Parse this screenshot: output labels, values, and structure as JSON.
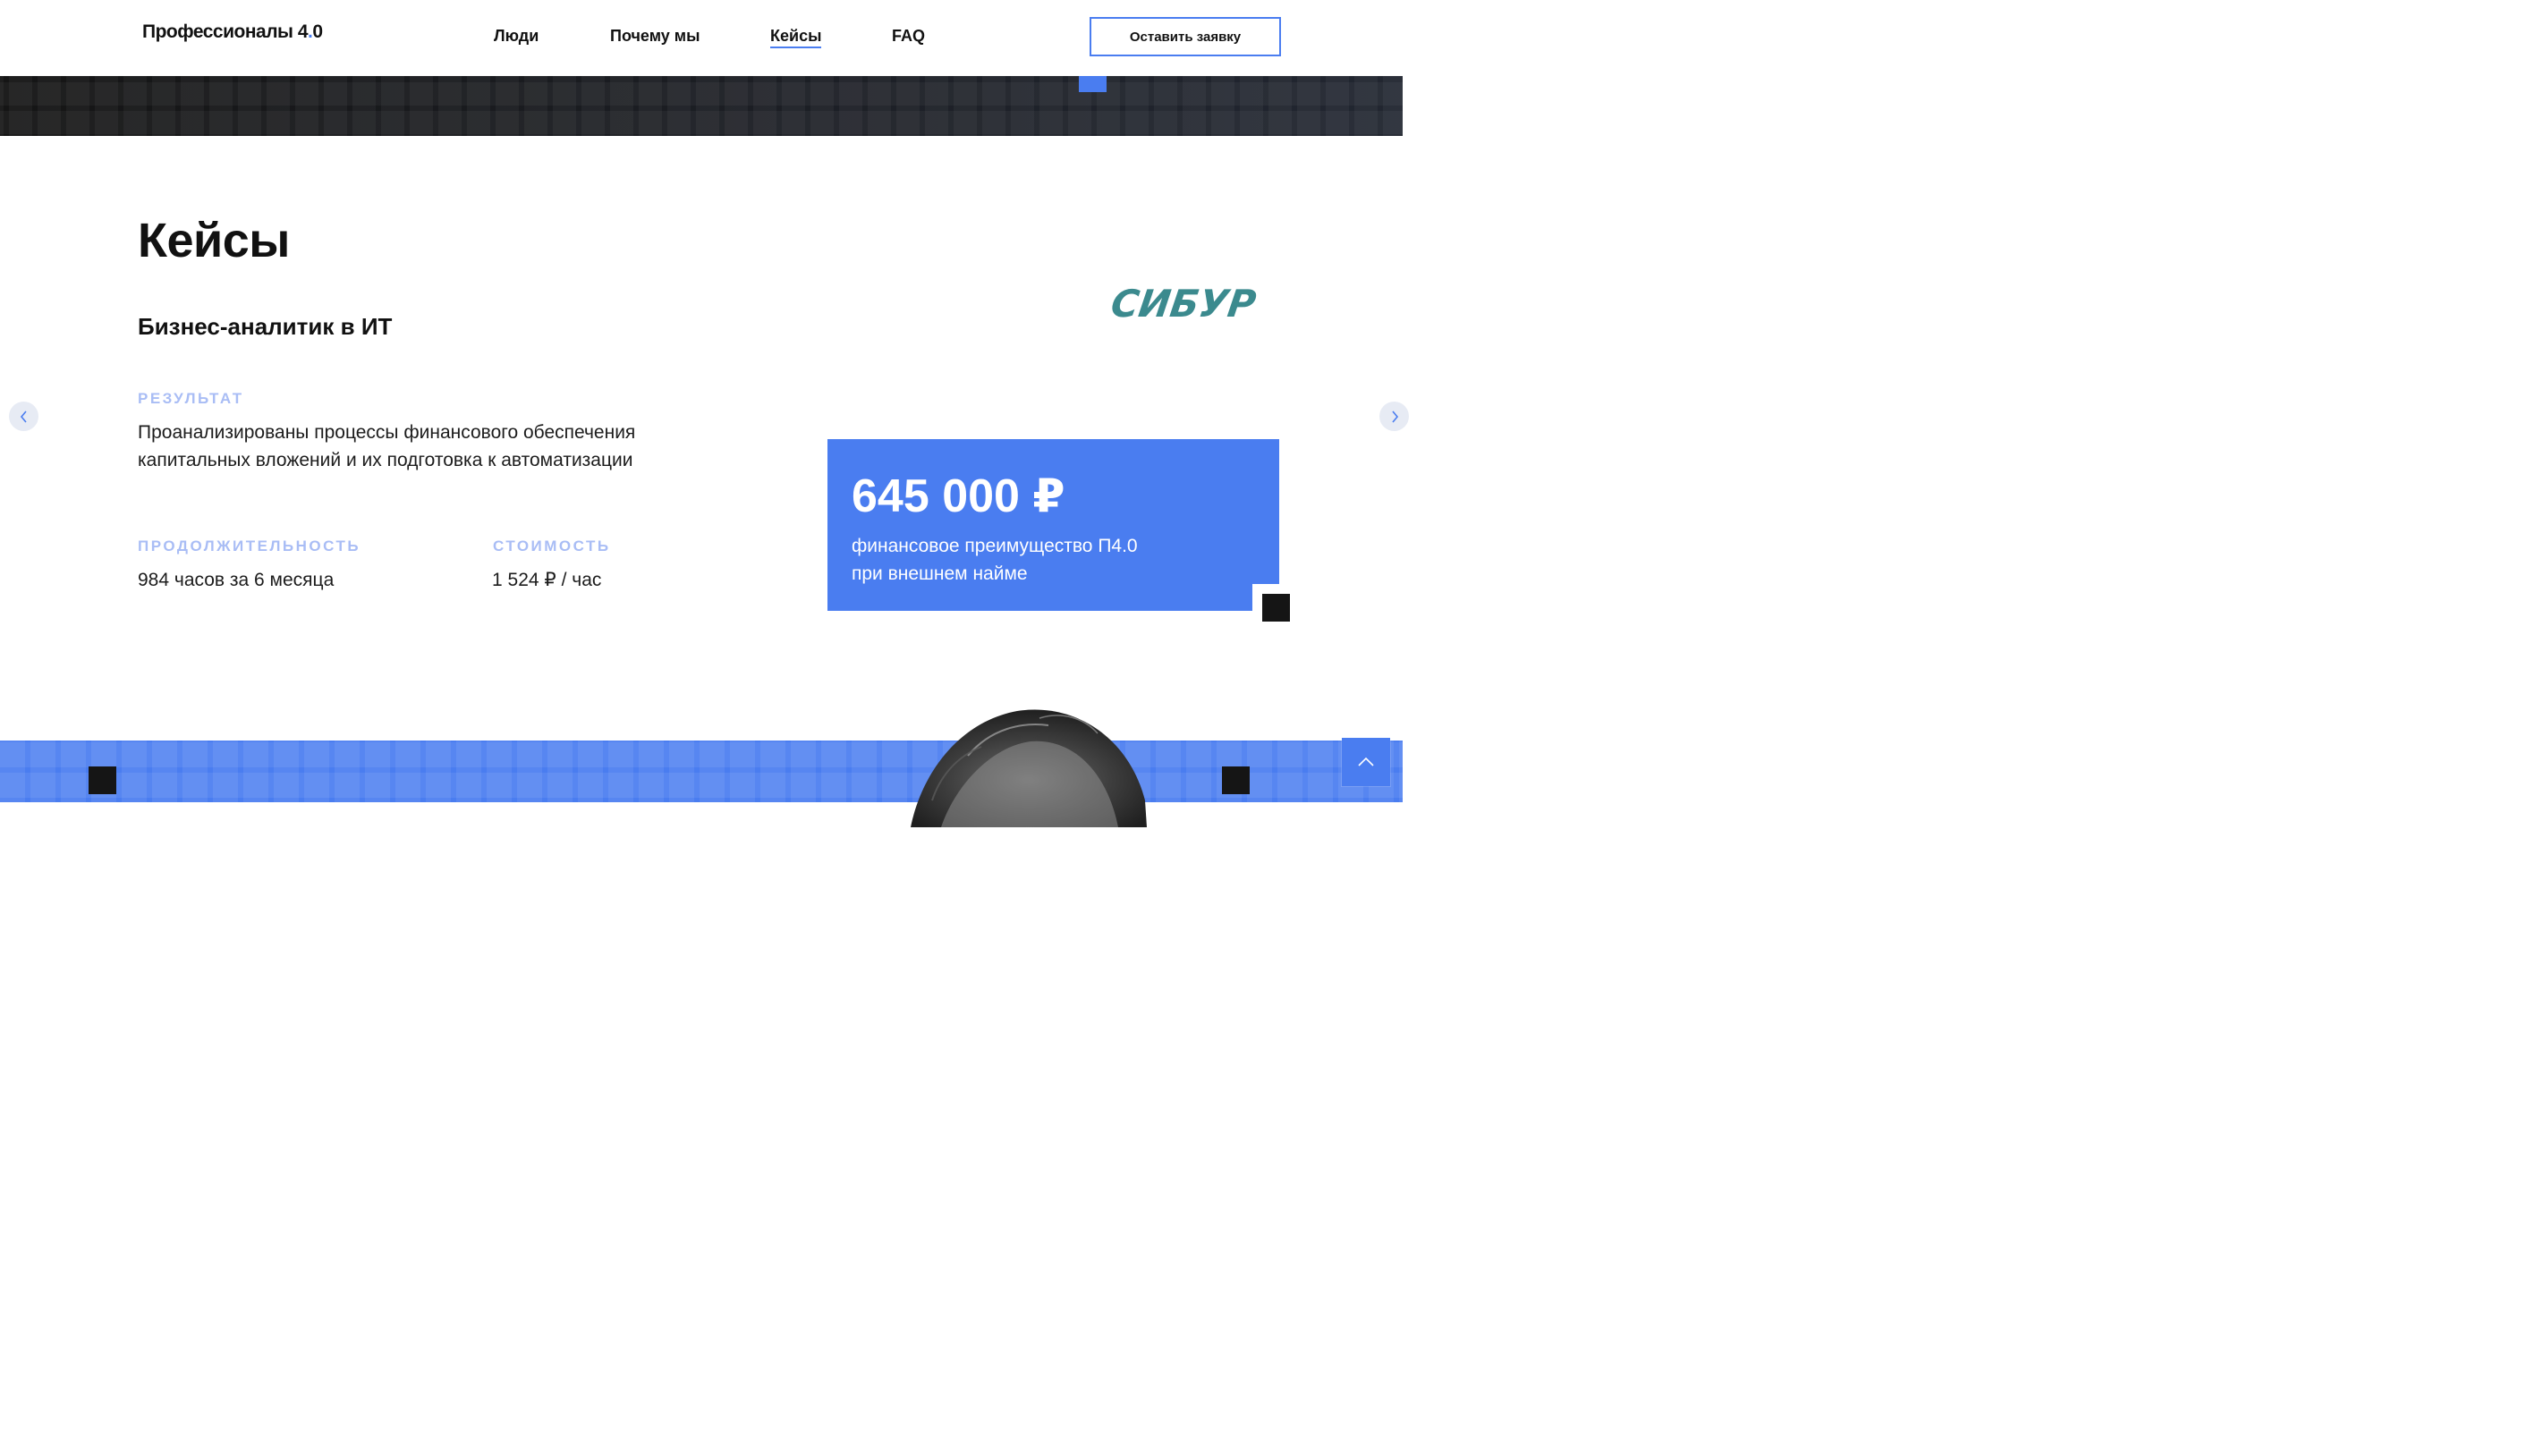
{
  "header": {
    "logo_text": "Профессионалы 4",
    "logo_dot": ".",
    "logo_tail": "0",
    "nav": [
      {
        "label": "Люди"
      },
      {
        "label": "Почему мы"
      },
      {
        "label": "Кейсы",
        "active": true
      },
      {
        "label": "FAQ"
      }
    ],
    "cta_label": "Оставить заявку"
  },
  "section": {
    "title": "Кейсы"
  },
  "case": {
    "title": "Бизнес-аналитик в ИТ",
    "company_logo": "СИБУР",
    "result_label": "РЕЗУЛЬТАТ",
    "result_line1": "Проанализированы процессы финансового обеспечения",
    "result_line2": "капитальных вложений и их подготовка к автоматизации",
    "duration_label": "ПРОДОЛЖИТЕЛЬНОСТЬ",
    "duration_value": "984 часов за 6 месяца",
    "cost_label": "СТОИМОСТЬ",
    "cost_value": "1 524 ₽ / час"
  },
  "savings": {
    "amount": "645 000 ₽",
    "desc_line1": "финансовое преимущество П4.0",
    "desc_line2": "при внешнем найме"
  },
  "icons": {
    "prev": "chevron-left-icon",
    "next": "chevron-right-icon",
    "scroll_top": "chevron-up-icon"
  },
  "colors": {
    "accent": "#4a7df0",
    "label": "#a9bdf5",
    "sibur": "#3b8a8e",
    "dark": "#151515"
  }
}
